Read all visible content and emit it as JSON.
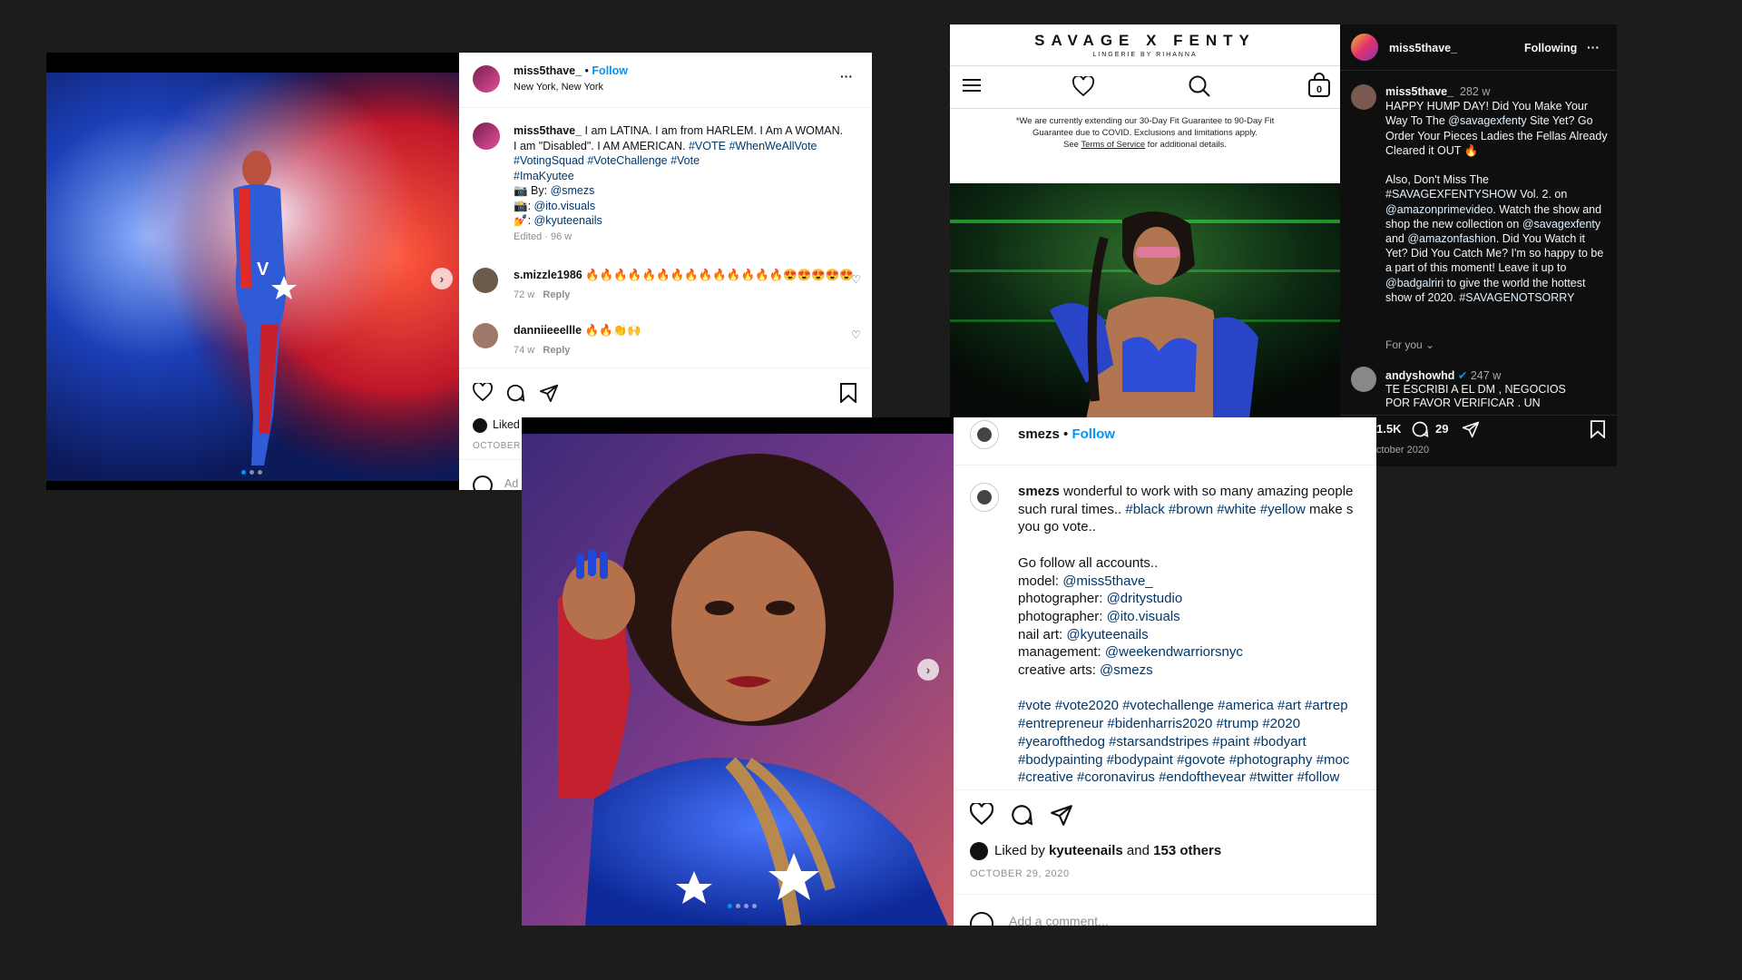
{
  "post1": {
    "username": "miss5thave_",
    "follow": "Follow",
    "dot": "•",
    "location": "New York, New York",
    "more": "···",
    "caption_user": "miss5thave_",
    "caption_text": "I am LATINA. I am from HARLEM. I Am A WOMAN. I am \"Disabled\". I AM AMERICAN.",
    "caption_tags1": "#VOTE",
    "caption_tags2": "#WhenWeAllVote #VotingSquad #VoteChallenge #Vote",
    "caption_tags3": "#ImaKyutee",
    "credit1_prefix": "📷 By: ",
    "credit1_link": "@smezs",
    "credit2_prefix": "📸: ",
    "credit2_link": "@ito.visuals",
    "credit3_prefix": "💅: ",
    "credit3_link": "@kyuteenails",
    "edited": "Edited · 96 w",
    "comments": [
      {
        "user": "s.mizzle1986",
        "text": "🔥🔥🔥🔥🔥🔥🔥🔥🔥🔥🔥🔥🔥🔥😍😍😍😍😍",
        "time": "72 w",
        "reply": "Reply"
      },
      {
        "user": "danniieeellle",
        "text": "🔥🔥👏🙌",
        "time": "74 w",
        "reply": "Reply"
      }
    ],
    "liked_by": "Liked",
    "date": "OCTOBER 2",
    "add_comment": "Ad"
  },
  "savage": {
    "brand": "SAVAGE X FENTY",
    "sub": "LINGERIE BY RIHANNA",
    "bag_count": "0",
    "notice_line1": "*We are currently extending our 30-Day Fit Guarantee to 90-Day Fit",
    "notice_line2": "Guarantee due to COVID. Exclusions and limitations apply.",
    "notice_line3_prefix": "See ",
    "notice_terms": "Terms of Service",
    "notice_line3_suffix": " for additional details."
  },
  "dark": {
    "username": "miss5thave_",
    "following": "Following",
    "more": "···",
    "cap_user": "miss5thave_",
    "cap_time": "282 w",
    "p1": "HAPPY HUMP DAY! Did You Make Your Way To The",
    "p1_link": "@savagexfenty",
    "p1b": "Site Yet? Go Order Your Pieces Ladies the Fellas Already Cleared it OUT 🔥",
    "p2a": "Also, Don't Miss The",
    "p2_tag": "#SAVAGEXFENTYSHOW",
    "p2b": "Vol. 2. on",
    "p2_link1": "@amazonprimevideo",
    "p2c": ". Watch the show and shop the new collection on",
    "p2_link2": "@savagexfenty",
    "p2d": "and",
    "p2_link3": "@amazonfashion",
    "p2e": ". Did You Watch it Yet? Did You Catch Me? I'm so happy to be a part of this moment! Leave it up to",
    "p2_link4": "@badgalriri",
    "p2f": "to give the world the hottest show of 2020.",
    "p2_tag2": "#SAVAGENOTSORRY",
    "for_you": "For you ⌄",
    "c_user": "andyshowhd",
    "c_time": "247 w",
    "c_text": "TE ESCRIBI A EL DM , NEGOCIOS POR FAVOR VERIFICAR . UN",
    "likes": "1.5K",
    "comments": "29",
    "date": "ctober 2020"
  },
  "post2": {
    "username": "smezs",
    "dot": "•",
    "follow": "Follow",
    "cap_user": "smezs",
    "cap_l1": "wonderful to work with so many amazing people",
    "cap_l2a": "such rural times..",
    "cap_l2_tags": "#black #brown #white #yellow",
    "cap_l2b": "make s",
    "cap_l3": "you go vote..",
    "follow_all": "Go follow all accounts..",
    "credits": [
      {
        "label": "model: ",
        "link": "@miss5thave_"
      },
      {
        "label": "photographer: ",
        "link": "@dritystudio"
      },
      {
        "label": "photographer: ",
        "link": "@ito.visuals"
      },
      {
        "label": "nail art: ",
        "link": "@kyuteenails"
      },
      {
        "label": "management: ",
        "link": "@weekendwarriorsnyc"
      },
      {
        "label": "creative arts: ",
        "link": "@smezs"
      }
    ],
    "tags1": "#vote #vote2020 #votechallenge #america #art #artrep",
    "tags2": "#entrepreneur #bidenharris2020 #trump #2020",
    "tags3": "#yearofthedog #starsandstripes #paint #bodyart",
    "tags4": "#bodypainting #bodypaint #govote #photography #moc",
    "tags5": "#creative #coronavirus #endoftheyear #twitter #follow",
    "liked_prefix": "Liked by ",
    "liked_user": "kyuteenails",
    "liked_mid": " and ",
    "liked_others": "153 others",
    "date": "OCTOBER 29, 2020",
    "add_comment": "Add a comment..."
  }
}
